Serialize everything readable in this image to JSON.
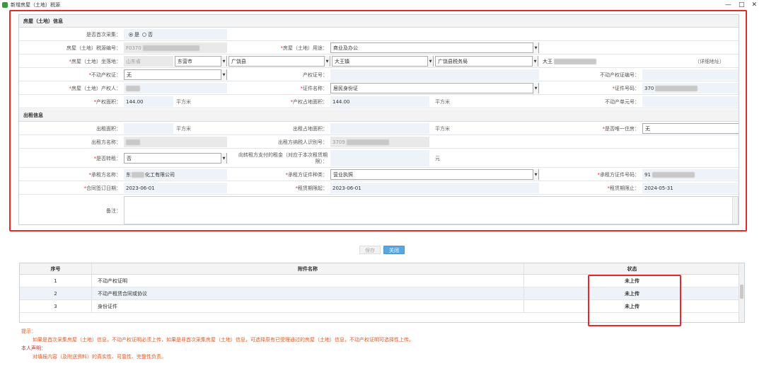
{
  "window": {
    "title": "新增房屋（土地）税源",
    "controls": [
      "—",
      "□",
      "✕"
    ]
  },
  "section_property": {
    "title": "房屋（土地）信息",
    "first_collect_label": "是否首次采集：",
    "first_collect_yes": "是",
    "first_collect_no": "否",
    "tax_source_no_label": "房屋（土地）税源编号：",
    "tax_source_no_value": "F0370",
    "usage_label": "房屋（土地）用途：",
    "usage_value": "商业及办公",
    "location_label": "房屋（土地）坐落地：",
    "location_province": "山东省",
    "location_city": "东营市",
    "location_district": "广饶县",
    "location_town": "大王镇",
    "location_tax_office": "广饶县税务局",
    "location_detail": "大王",
    "location_detail_hint": "（详细地址）",
    "cert_label": "不动产权证：",
    "cert_value": "无",
    "ownership_cert_label": "产权证号：",
    "realestate_cert_label": "不动产权证编号：",
    "owner_label": "房屋（土地）产权人：",
    "id_type_label": "证件名称：",
    "id_type_value": "居民身份证",
    "id_no_label": "证件号码：",
    "id_no_value": "370",
    "area_label": "产权面积：",
    "area_value": "144.00",
    "area_unit": "平方米",
    "land_area_label": "产权占地面积：",
    "land_area_value": "144.00",
    "land_area_unit": "平方米",
    "unit_no_label": "不动产单元号："
  },
  "section_lease": {
    "title": "出租信息",
    "lease_area_label": "出租面积：",
    "lease_area_unit": "平方米",
    "lease_land_area_label": "出租占地面积：",
    "lease_land_area_unit": "平方米",
    "only_house_label": "是否唯一住房：",
    "only_house_value": "无",
    "lessor_name_label": "出租方名称：",
    "lessor_taxid_label": "出租方纳税人识别号：",
    "lessor_taxid_value": "3709",
    "sublet_label": "是否转租：",
    "sublet_value": "否",
    "sublet_fee_label": "向转租方支付的租金（对应于本次租赁期限）：",
    "sublet_fee_unit": "元",
    "lessee_name_label": "承租方名称：",
    "lessee_name_prefix": "东",
    "lessee_name_suffix": "化工有限公司",
    "lessee_id_type_label": "承租方证件种类：",
    "lessee_id_type_value": "营业执照",
    "lessee_id_no_label": "承租方证件号码：",
    "lessee_id_no_value": "91",
    "contract_date_label": "合同签订日期：",
    "contract_date_value": "2023-06-01",
    "lease_start_label": "租赁期限起：",
    "lease_start_value": "2023-06-01",
    "lease_end_label": "租赁期限止：",
    "lease_end_value": "2024-05-31",
    "remark_label": "备注："
  },
  "buttons": {
    "save": "保存",
    "close": "关闭"
  },
  "attachments": {
    "headers": [
      "序号",
      "附件名称",
      "状态"
    ],
    "rows": [
      {
        "no": "1",
        "name": "不动产权证明",
        "status": "未上传"
      },
      {
        "no": "2",
        "name": "不动产租赁合同或协议",
        "status": "未上传"
      },
      {
        "no": "3",
        "name": "身份证件",
        "status": "未上传"
      }
    ]
  },
  "hints": {
    "tip_title": "提示：",
    "tip_body": "如果是首次采集房屋（土地）信息，不动产权证明必须上传，如果是非首次采集房屋（土地）信息，可选择原有已受理通过的房屋（土地）信息，不动产权证明可选择性上传。",
    "declare_title": "本人声明：",
    "declare_body": "对填报内容（及附送资料）的真实性、可靠性、完整性负责。"
  }
}
